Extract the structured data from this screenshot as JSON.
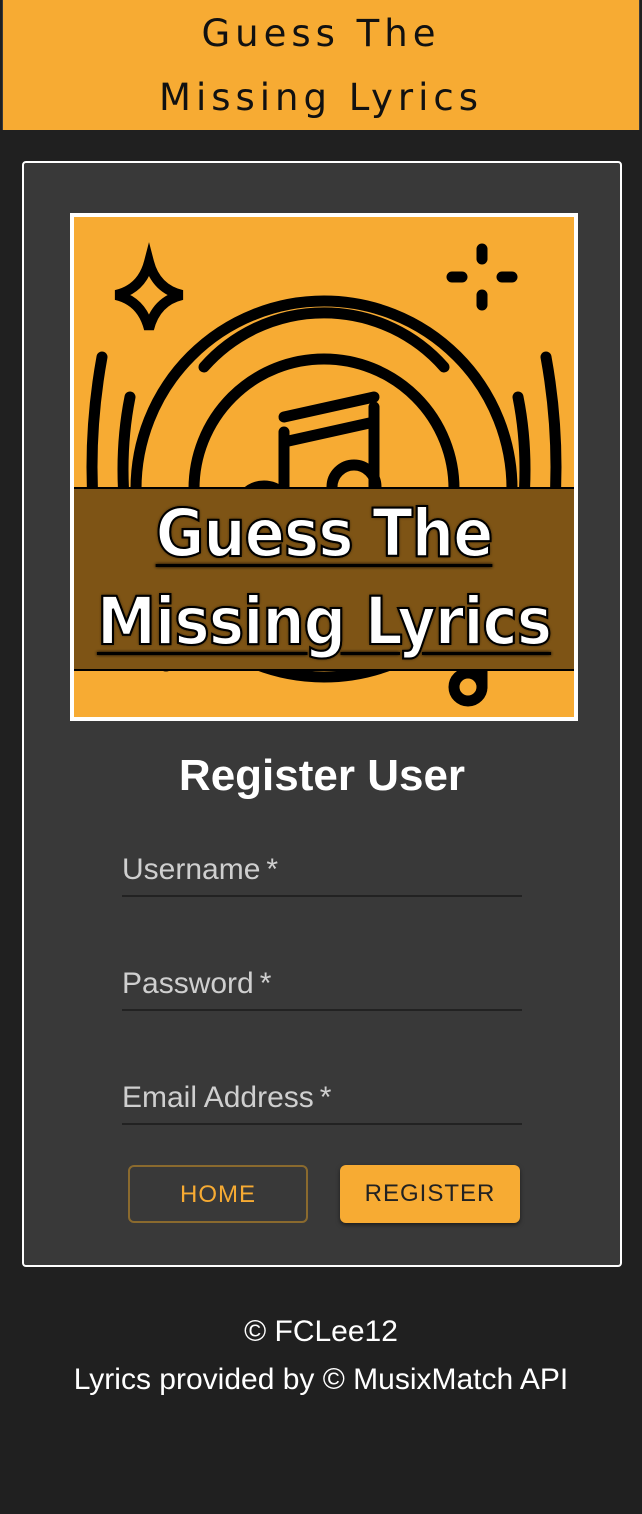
{
  "header": {
    "title_line1": "Guess The",
    "title_line2": "Missing Lyrics"
  },
  "logo": {
    "text_line1": "Guess The",
    "text_line2": "Missing Lyrics",
    "icon": "music-disc-icon"
  },
  "form": {
    "title": "Register User",
    "username_label": "Username",
    "password_label": "Password",
    "email_label": "Email Address",
    "required_mark": "*",
    "home_label": "HOME",
    "register_label": "REGISTER"
  },
  "footer": {
    "copyright": "© FCLee12",
    "credit": "Lyrics provided by © MusixMatch API"
  },
  "colors": {
    "accent": "#f7ab33",
    "background": "#202020",
    "card": "#393939",
    "banner": "#7e5415"
  }
}
